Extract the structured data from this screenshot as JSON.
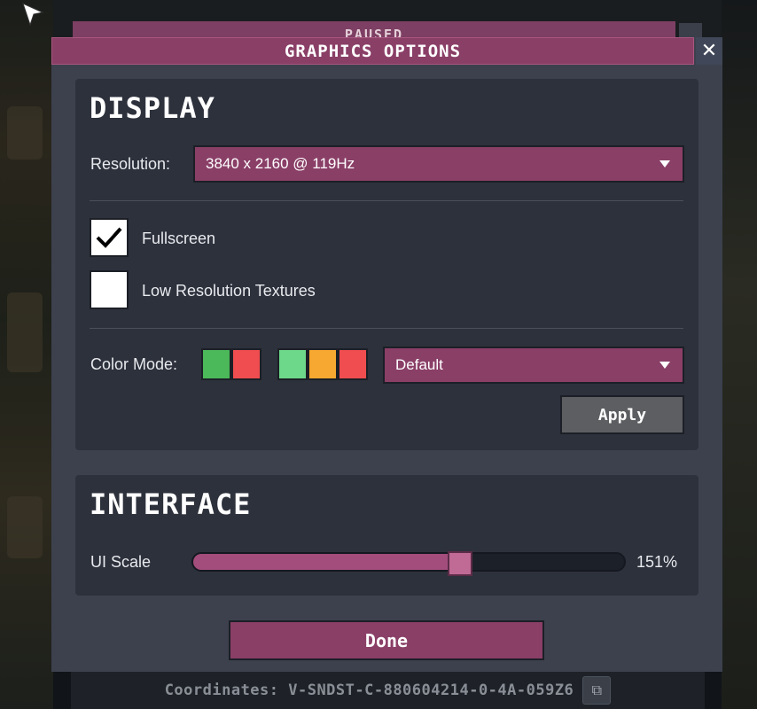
{
  "window": {
    "title": "GRAPHICS OPTIONS",
    "background_title": "PAUSED",
    "close_icon": "close-icon"
  },
  "display": {
    "heading": "DISPLAY",
    "resolution_label": "Resolution:",
    "resolution_value": "3840 x 2160 @ 119Hz",
    "fullscreen_label": "Fullscreen",
    "fullscreen_checked": true,
    "low_res_label": "Low Resolution Textures",
    "low_res_checked": false,
    "color_mode_label": "Color Mode:",
    "color_mode_swatches_a": [
      "#4bb85a",
      "#ef4d4f"
    ],
    "color_mode_swatches_b": [
      "#6dd88a",
      "#f7a830",
      "#ef4d4f"
    ],
    "color_mode_value": "Default",
    "apply_label": "Apply"
  },
  "interface": {
    "heading": "INTERFACE",
    "ui_scale_label": "UI Scale",
    "ui_scale_value": "151%",
    "ui_scale_fraction": 0.62
  },
  "done_label": "Done",
  "footer": {
    "coordinates": "Coordinates: V-SNDST-C-880604214-0-4A-059Z6",
    "copy_icon": "copy-icon"
  },
  "colors": {
    "accent": "#8a3f67",
    "panel": "#2d313c",
    "dialog": "#3c414d"
  }
}
